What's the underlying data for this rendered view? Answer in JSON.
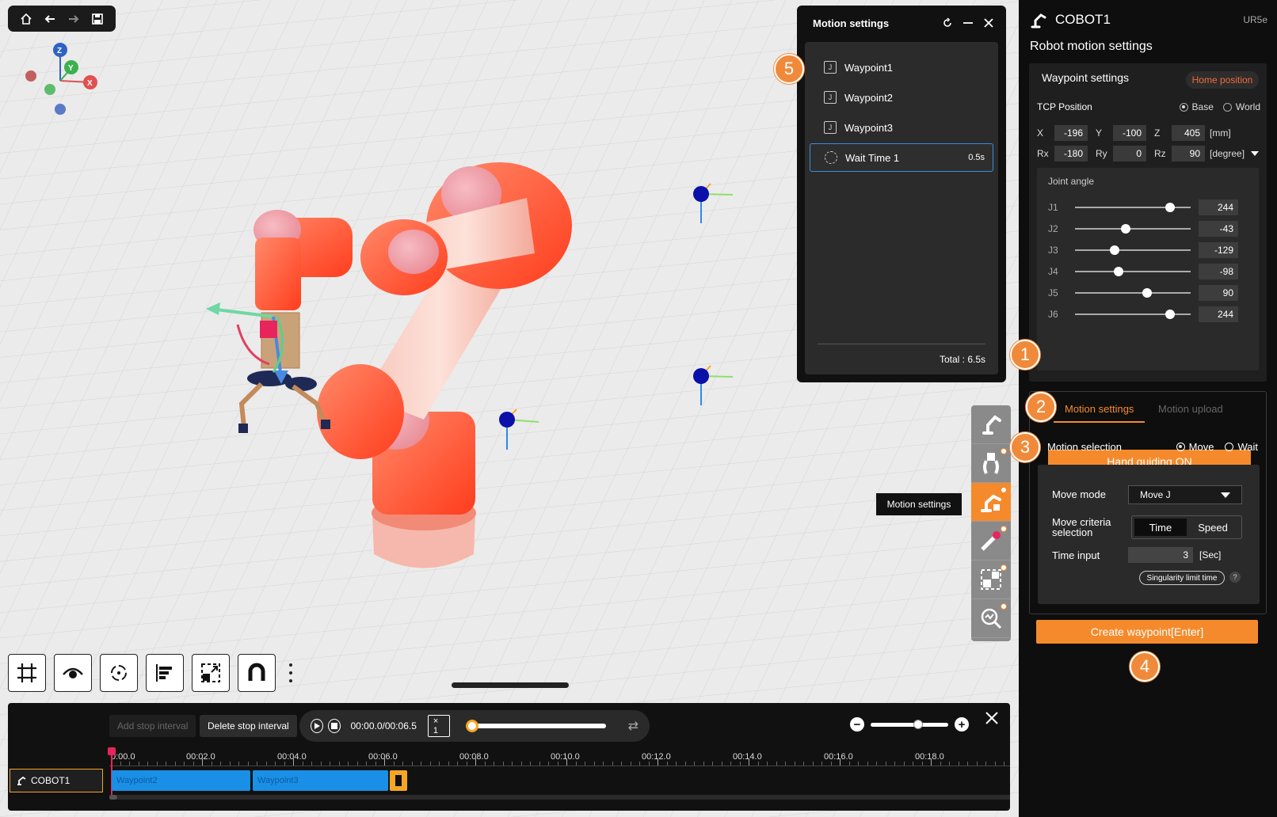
{
  "viewport": {
    "top_toolbar": {
      "icons": [
        "home-icon",
        "back-arrow-icon",
        "forward-arrow-icon",
        "save-icon"
      ]
    },
    "axes": {
      "x": "X",
      "y": "Y",
      "z": "Z"
    },
    "bottom_tools": [
      "grid-icon",
      "eye-icon",
      "rotate-icon",
      "align-icon",
      "resize-icon",
      "magnet-icon",
      "more-icon"
    ],
    "tooltip": "Motion settings",
    "callouts": [
      "1",
      "2",
      "3",
      "4",
      "5"
    ]
  },
  "motion_panel": {
    "title": "Motion settings",
    "items": [
      {
        "label": "Waypoint1",
        "icon": "J"
      },
      {
        "label": "Waypoint2",
        "icon": "J"
      },
      {
        "label": "Waypoint3",
        "icon": "J"
      },
      {
        "label": "Wait Time 1",
        "duration": "0.5s"
      }
    ],
    "total": "Total : 6.5s"
  },
  "timeline": {
    "add_stop": "Add stop interval",
    "delete_stop": "Delete stop interval",
    "time": "00:00.0/00:06.5",
    "speed": "× 1",
    "ruler": [
      "0:00.0",
      "00:02.0",
      "00:04.0",
      "00:06.0",
      "00:08.0",
      "00:10.0",
      "00:12.0",
      "00:14.0",
      "00:16.0",
      "00:18.0"
    ],
    "track_name": "COBOT1",
    "segments": [
      "Waypoint2",
      "Waypoint3"
    ]
  },
  "sidebar": {
    "robot_name": "COBOT1",
    "model": "UR5e",
    "title": "Robot motion settings",
    "waypoint_settings": "Waypoint settings",
    "home_position": "Home position",
    "tcp_label": "TCP Position",
    "frame_base": "Base",
    "frame_world": "World",
    "coords": {
      "x_label": "X",
      "x": "-196",
      "y_label": "Y",
      "y": "-100",
      "z_label": "Z",
      "z": "405",
      "mm": "[mm]",
      "rx_label": "Rx",
      "rx": "-180",
      "ry_label": "Ry",
      "ry": "0",
      "rz_label": "Rz",
      "rz": "90",
      "degree": "[degree]"
    },
    "joint_title": "Joint angle",
    "joints": [
      {
        "label": "J1",
        "value": "244",
        "level": 0.82
      },
      {
        "label": "J2",
        "value": "-43",
        "level": 0.44
      },
      {
        "label": "J3",
        "value": "-129",
        "level": 0.34
      },
      {
        "label": "J4",
        "value": "-98",
        "level": 0.38
      },
      {
        "label": "J5",
        "value": "90",
        "level": 0.62
      },
      {
        "label": "J6",
        "value": "244",
        "level": 0.82
      }
    ],
    "hand_guiding": "Hand guiding ON",
    "tab_motion_settings": "Motion settings",
    "tab_motion_upload": "Motion upload",
    "motion_selection": "Motion selection",
    "move": "Move",
    "wait": "Wait",
    "move_mode_label": "Move mode",
    "move_mode_value": "Move J",
    "criteria_label": "Move criteria selection",
    "criteria_time": "Time",
    "criteria_speed": "Speed",
    "time_input_label": "Time input",
    "time_input_value": "3",
    "time_unit": "[Sec]",
    "singularity": "Singularity limit time",
    "help": "?",
    "create_waypoint": "Create waypoint[Enter]"
  },
  "colors": {
    "accent": "#f58a2c",
    "segment": "#1a8fe6",
    "playhead": "#e8245d"
  }
}
